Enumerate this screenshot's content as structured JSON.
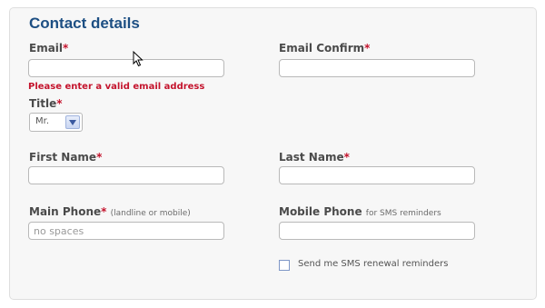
{
  "form": {
    "title": "Contact details",
    "email": {
      "label": "Email",
      "required_mark": "*",
      "value": "",
      "error": "Please enter a valid email address"
    },
    "email_confirm": {
      "label": "Email Confirm",
      "required_mark": "*",
      "value": ""
    },
    "title_field": {
      "label": "Title",
      "required_mark": "*",
      "selected": "Mr."
    },
    "first_name": {
      "label": "First Name",
      "required_mark": "*",
      "value": ""
    },
    "last_name": {
      "label": "Last Name",
      "required_mark": "*",
      "value": ""
    },
    "main_phone": {
      "label": "Main Phone",
      "required_mark": "*",
      "hint": "(landline or mobile)",
      "placeholder": "no spaces",
      "value": ""
    },
    "mobile_phone": {
      "label": "Mobile Phone",
      "hint": "for SMS reminders",
      "value": ""
    },
    "sms_reminders": {
      "label": "Send me SMS renewal reminders",
      "checked": false
    }
  },
  "colors": {
    "title": "#1d4f83",
    "required": "#c4142d",
    "error": "#c4142d",
    "panel_bg": "#f7f7f7"
  }
}
